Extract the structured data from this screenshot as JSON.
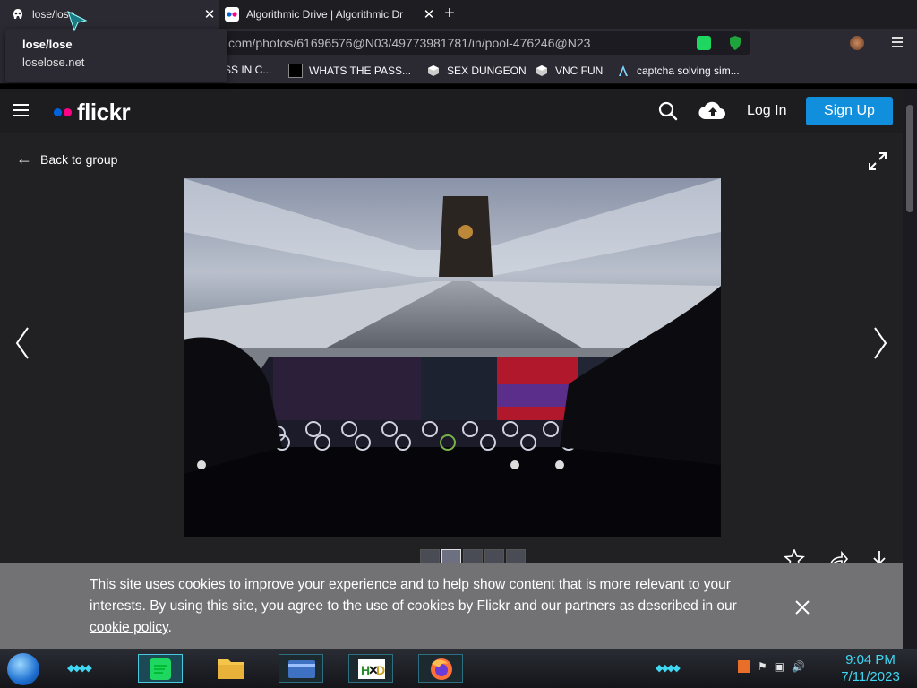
{
  "tabs": [
    {
      "title": "lose/lose",
      "favicon": "alien-icon",
      "active": true
    },
    {
      "title": "Algorithmic Drive | Algorithmic Dr",
      "favicon": "flickr-icon",
      "active": false
    }
  ],
  "tooltip": {
    "title": "lose/lose",
    "url": "loselose.net"
  },
  "address_bar": {
    "url": "com/photos/61696576@N03/49773981781/in/pool-476246@N23"
  },
  "bookmarks": [
    {
      "label": "SS IN C...",
      "icon": "bookmark-icon"
    },
    {
      "label": "WHATS THE PASS...",
      "icon": "bookmark-icon"
    },
    {
      "label": "SEX DUNGEON",
      "icon": "cube-icon"
    },
    {
      "label": "VNC FUN",
      "icon": "cube-icon"
    },
    {
      "label": "captcha solving sim...",
      "icon": "a-logo-icon"
    }
  ],
  "flickr": {
    "logo_text": "flickr",
    "login_label": "Log In",
    "signup_label": "Sign Up",
    "back_label": "Back to group",
    "colors": {
      "accent": "#128fdc",
      "dot_blue": "#0063dc",
      "dot_pink": "#ff0084"
    }
  },
  "cookie_banner": {
    "text": "This site uses cookies to improve your experience and to help show content that is more relevant to your interests. By using this site, you agree to the use of cookies by Flickr and our partners as described in our ",
    "link_text": "cookie policy",
    "suffix": "."
  },
  "taskbar": {
    "time": "9:04 PM",
    "date": "7/11/2023",
    "apps": [
      "spotify-icon",
      "file-explorer-icon",
      "card-icon",
      "hxd-icon",
      "firefox-icon"
    ]
  }
}
